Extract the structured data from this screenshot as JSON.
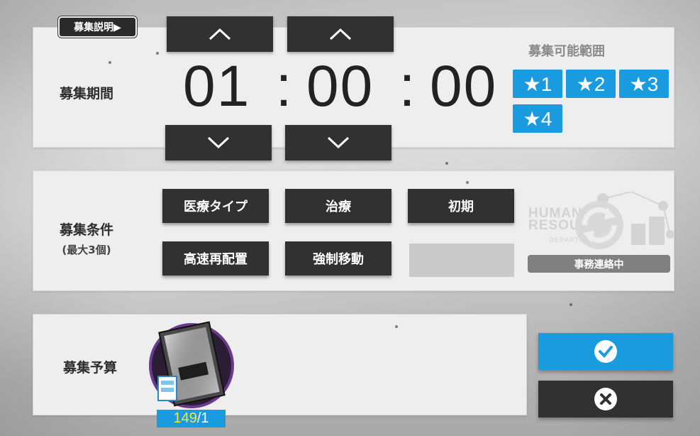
{
  "recruit_info_button": "募集説明▶",
  "duration": {
    "label": "募集期間",
    "hours": "01",
    "minutes": "00",
    "seconds": "00",
    "separator": ":"
  },
  "rarity_range": {
    "title": "募集可能範囲",
    "stars": [
      "★1",
      "★2",
      "★3",
      "★4"
    ]
  },
  "conditions": {
    "label": "募集条件",
    "sub_label": "(最大3個)",
    "tags": [
      "医療タイプ",
      "治療",
      "初期",
      "高速再配置",
      "強制移動"
    ]
  },
  "department": {
    "logo_text_line1": "HUMAN",
    "logo_text_line2": "RESOURCES",
    "logo_text_line3": "DEPARTMENT",
    "status": "事務連絡中"
  },
  "budget": {
    "label": "募集予算",
    "permit_have": "149",
    "permit_cost": "/1"
  },
  "colors": {
    "accent_blue": "#1a9be0",
    "dark_button": "#313131",
    "panel_bg": "#eeeeee",
    "count_highlight": "#ffe22b"
  },
  "icons": {
    "up": "chevron-up-icon",
    "down": "chevron-down-icon",
    "confirm": "check-circle-icon",
    "cancel": "close-circle-icon",
    "refresh": "refresh-icon",
    "permit": "recruitment-permit-icon"
  }
}
